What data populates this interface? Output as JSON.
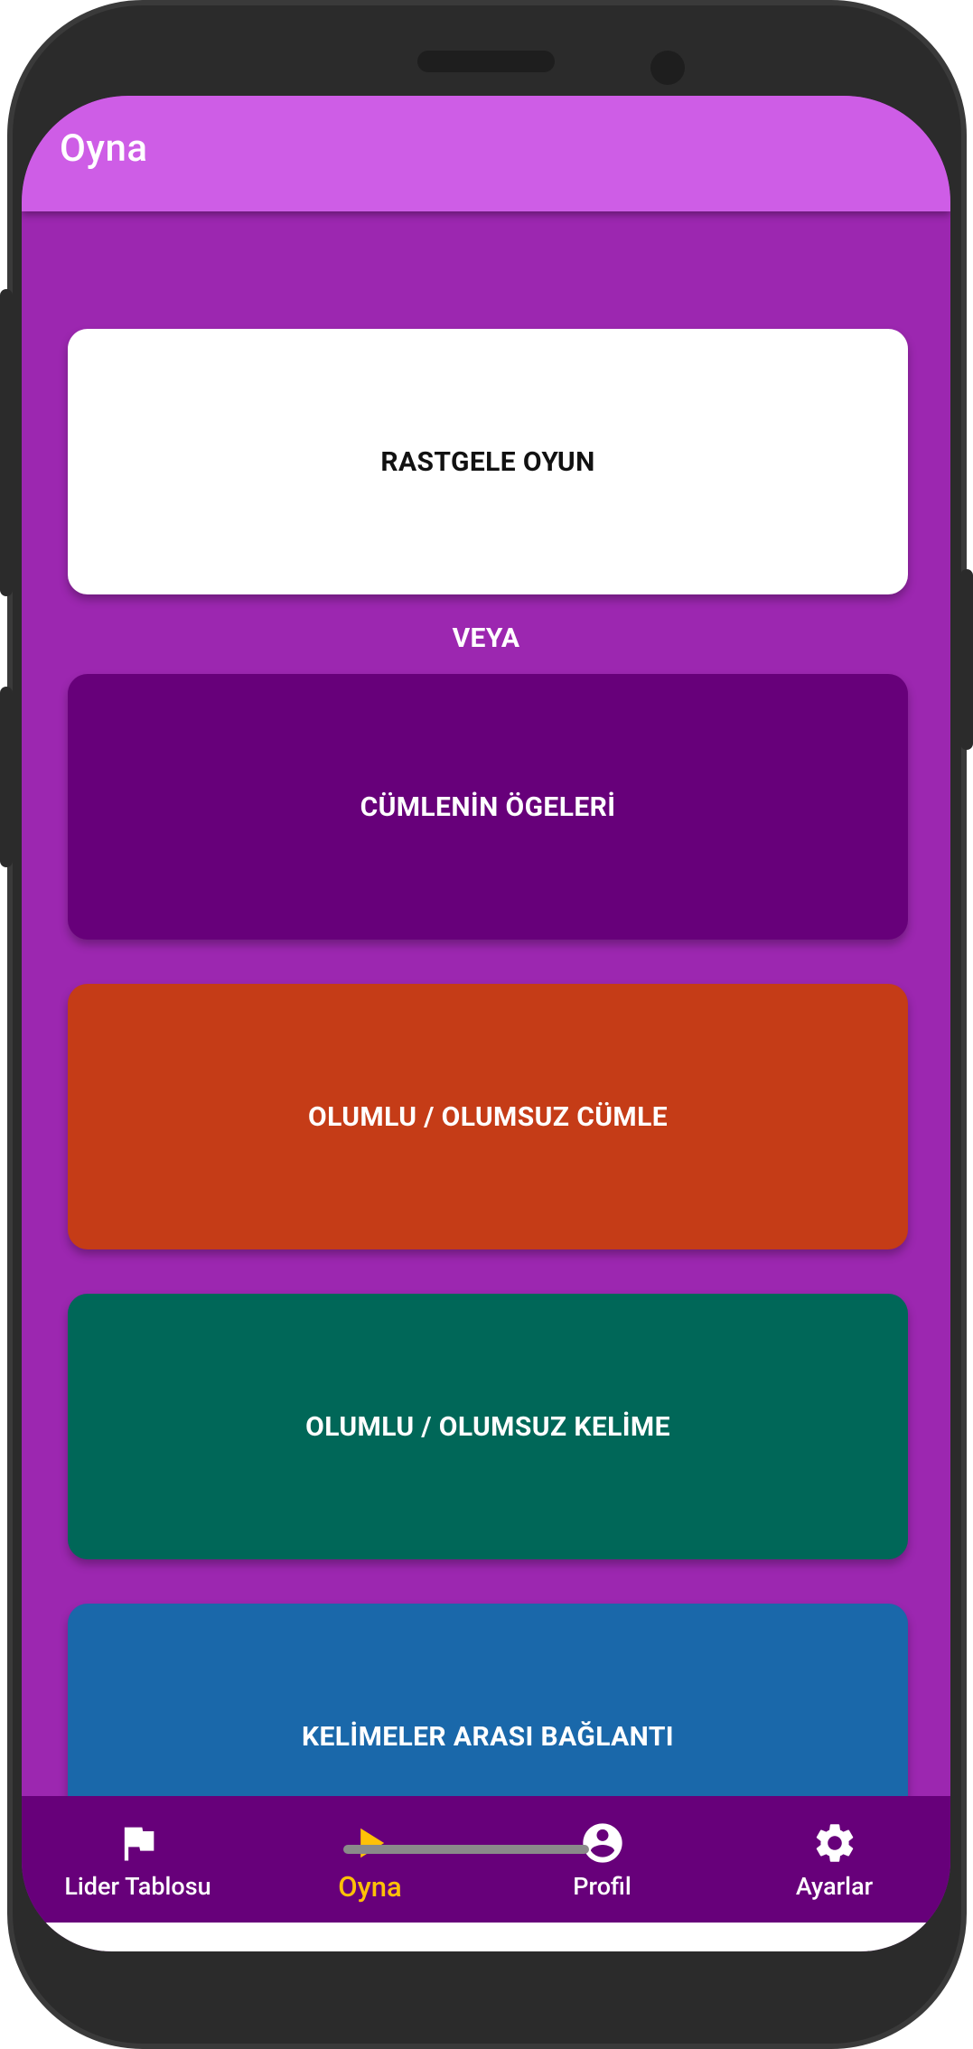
{
  "appbar": {
    "title": "Oyna"
  },
  "main": {
    "random_game_label": "RASTGELE OYUN",
    "separator_label": "VEYA",
    "categories": [
      {
        "label": "CÜMLENİN ÖGELERİ",
        "color": "#67007a"
      },
      {
        "label": "OLUMLU / OLUMSUZ CÜMLE",
        "color": "#c53c17"
      },
      {
        "label": "OLUMLU / OLUMSUZ KELİME",
        "color": "#006758"
      },
      {
        "label": "KELİMELER ARASI BAĞLANTI",
        "color": "#1a68aa"
      }
    ]
  },
  "bottom_nav": {
    "items": [
      {
        "label": "Lider Tablosu",
        "icon": "flag-icon",
        "active": false
      },
      {
        "label": "Oyna",
        "icon": "play-icon",
        "active": true
      },
      {
        "label": "Profil",
        "icon": "account-circle-icon",
        "active": false
      },
      {
        "label": "Ayarlar",
        "icon": "gear-icon",
        "active": false
      }
    ]
  },
  "colors": {
    "appbar": "#ce5de6",
    "background": "#9c27b0",
    "nav_background": "#67007a",
    "active_nav": "#ffc107"
  }
}
